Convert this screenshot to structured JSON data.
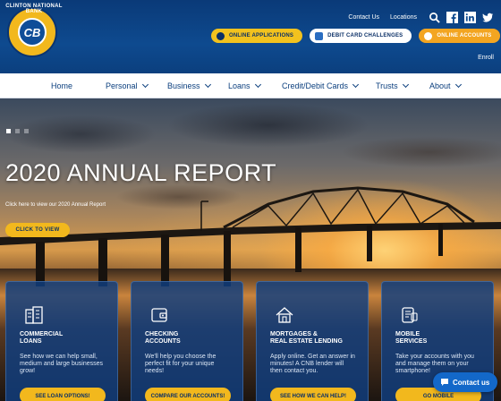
{
  "brand": {
    "logo_text": "CLINTON NATIONAL BANK",
    "monogram": "CB"
  },
  "toplinks": {
    "contact": "Contact Us",
    "locations": "Locations"
  },
  "pills": [
    {
      "label": "ONLINE APPLICATIONS"
    },
    {
      "label": "DEBIT CARD CHALLENGES"
    },
    {
      "label": "ONLINE ACCOUNTS"
    }
  ],
  "enroll": "Enroll",
  "nav": [
    {
      "label": "Home"
    },
    {
      "label": "Personal"
    },
    {
      "label": "Business"
    },
    {
      "label": "Loans"
    },
    {
      "label": "Credit/Debit Cards"
    },
    {
      "label": "Trusts"
    },
    {
      "label": "About"
    }
  ],
  "hero": {
    "title": "2020 ANNUAL REPORT",
    "subtitle": "Click here to view our 2020 Annual Report",
    "button": "CLICK TO VIEW"
  },
  "cards": [
    {
      "title": "COMMERCIAL\nLOANS",
      "desc": "See how we can help small, medium and large businesses grow!",
      "button": "SEE LOAN OPTIONS!",
      "icon": "building-icon"
    },
    {
      "title": "CHECKING\nACCOUNTS",
      "desc": "We'll help you choose the perfect fit for your unique needs!",
      "button": "COMPARE OUR ACCOUNTS!",
      "icon": "wallet-icon"
    },
    {
      "title": "MORTGAGES &\nREAL ESTATE LENDING",
      "desc": "Apply online. Get an answer in minutes! A CNB lender will then contact you.",
      "button": "SEE HOW WE CAN HELP!",
      "icon": "house-icon"
    },
    {
      "title": "MOBILE\nSERVICES",
      "desc": "Take your accounts with you and manage them on your smartphone!",
      "button": "GO MOBILE",
      "icon": "phone-icon"
    }
  ],
  "contact_widget": "Contact us",
  "colors": {
    "primary": "#0b3f7e",
    "accent": "#f2b81d",
    "orange": "#f3a521"
  }
}
